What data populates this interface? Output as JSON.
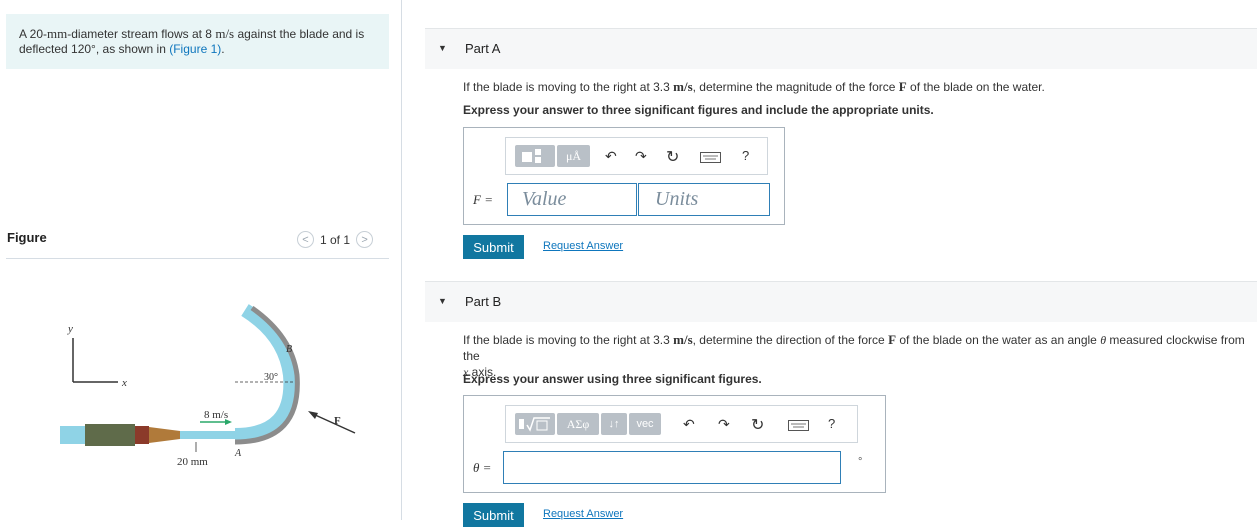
{
  "problem": {
    "text_a": "A 20-",
    "text_b": "mm",
    "text_c": "-diameter stream flows at 8 ",
    "text_d": "m/s",
    "text_e": " against the blade and is",
    "text_f": "deflected 120°, as shown in ",
    "link": "(Figure 1)",
    "text_g": "."
  },
  "figure": {
    "title": "Figure",
    "pager": "1 of 1",
    "prev": "<",
    "next": ">",
    "labels": {
      "y": "y",
      "x": "x",
      "angle": "30°",
      "B": "B",
      "A": "A",
      "F": "F",
      "speed": "8 m/s",
      "diameter": "20 mm"
    }
  },
  "partA": {
    "title": "Part A",
    "q1": "If the blade is moving to the right at 3.3 ",
    "q_unit": "m/s",
    "q2": ", determine the magnitude of the force ",
    "q_F": "F",
    "q3": " of the blade on the water.",
    "instruction": "Express your answer to three significant figures and include the appropriate units.",
    "var_label": "F =",
    "value_placeholder": "Value",
    "units_placeholder": "Units",
    "tool_mu": "μÅ",
    "help": "?",
    "submit": "Submit",
    "request": "Request Answer"
  },
  "partB": {
    "title": "Part B",
    "q1": "If the blade is moving to the right at 3.3 ",
    "q_unit": "m/s",
    "q2": ", determine the direction of the force ",
    "q_F": "F",
    "q3": " of the blade on the water as an angle ",
    "q_theta": "θ",
    "q4": " measured clockwise from the",
    "q5_var": "x",
    "q5": " axis.",
    "instruction": "Express your answer using three significant figures.",
    "var_label": "θ =",
    "unit_symbol": "°",
    "tool_sigma": "ΑΣφ",
    "tool_arrows": "↓↑",
    "tool_vec": "vec",
    "help": "?",
    "submit": "Submit",
    "request": "Request Answer"
  }
}
